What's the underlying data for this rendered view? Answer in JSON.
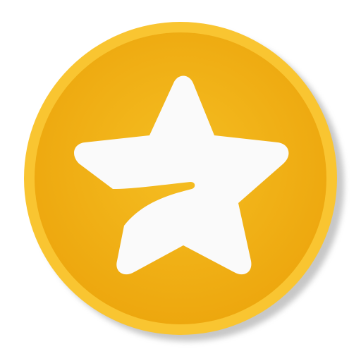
{
  "app_icon": {
    "name": "star-badge-icon",
    "colors": {
      "outer_ring": "#F9C531",
      "inner_face_light": "#F5BE22",
      "inner_face_dark": "#EDA70E",
      "star": "#FAFAFA",
      "shadow": "#9A9A9A"
    }
  }
}
